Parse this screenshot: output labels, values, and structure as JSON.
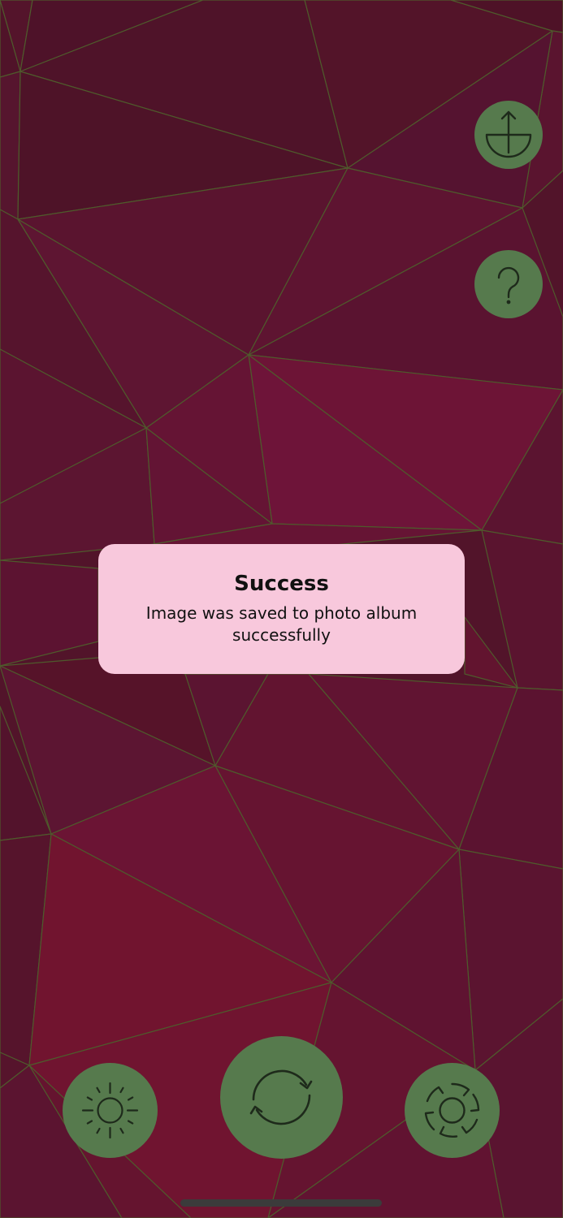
{
  "toast": {
    "title": "Success",
    "message": "Image was saved to photo album successfully"
  },
  "buttons": {
    "share": {
      "icon": "share-upload-icon"
    },
    "help": {
      "icon": "question-mark-icon"
    },
    "brightness": {
      "icon": "sun-icon"
    },
    "regenerate": {
      "icon": "refresh-icon"
    },
    "settings": {
      "icon": "aperture-icon"
    }
  },
  "colors": {
    "background": "#52142a",
    "button_fill": "#567a4d",
    "icon_stroke": "#1e2a1b",
    "toast_fill": "#f8c8dc",
    "mesh_lines": "#4f5a2c"
  }
}
